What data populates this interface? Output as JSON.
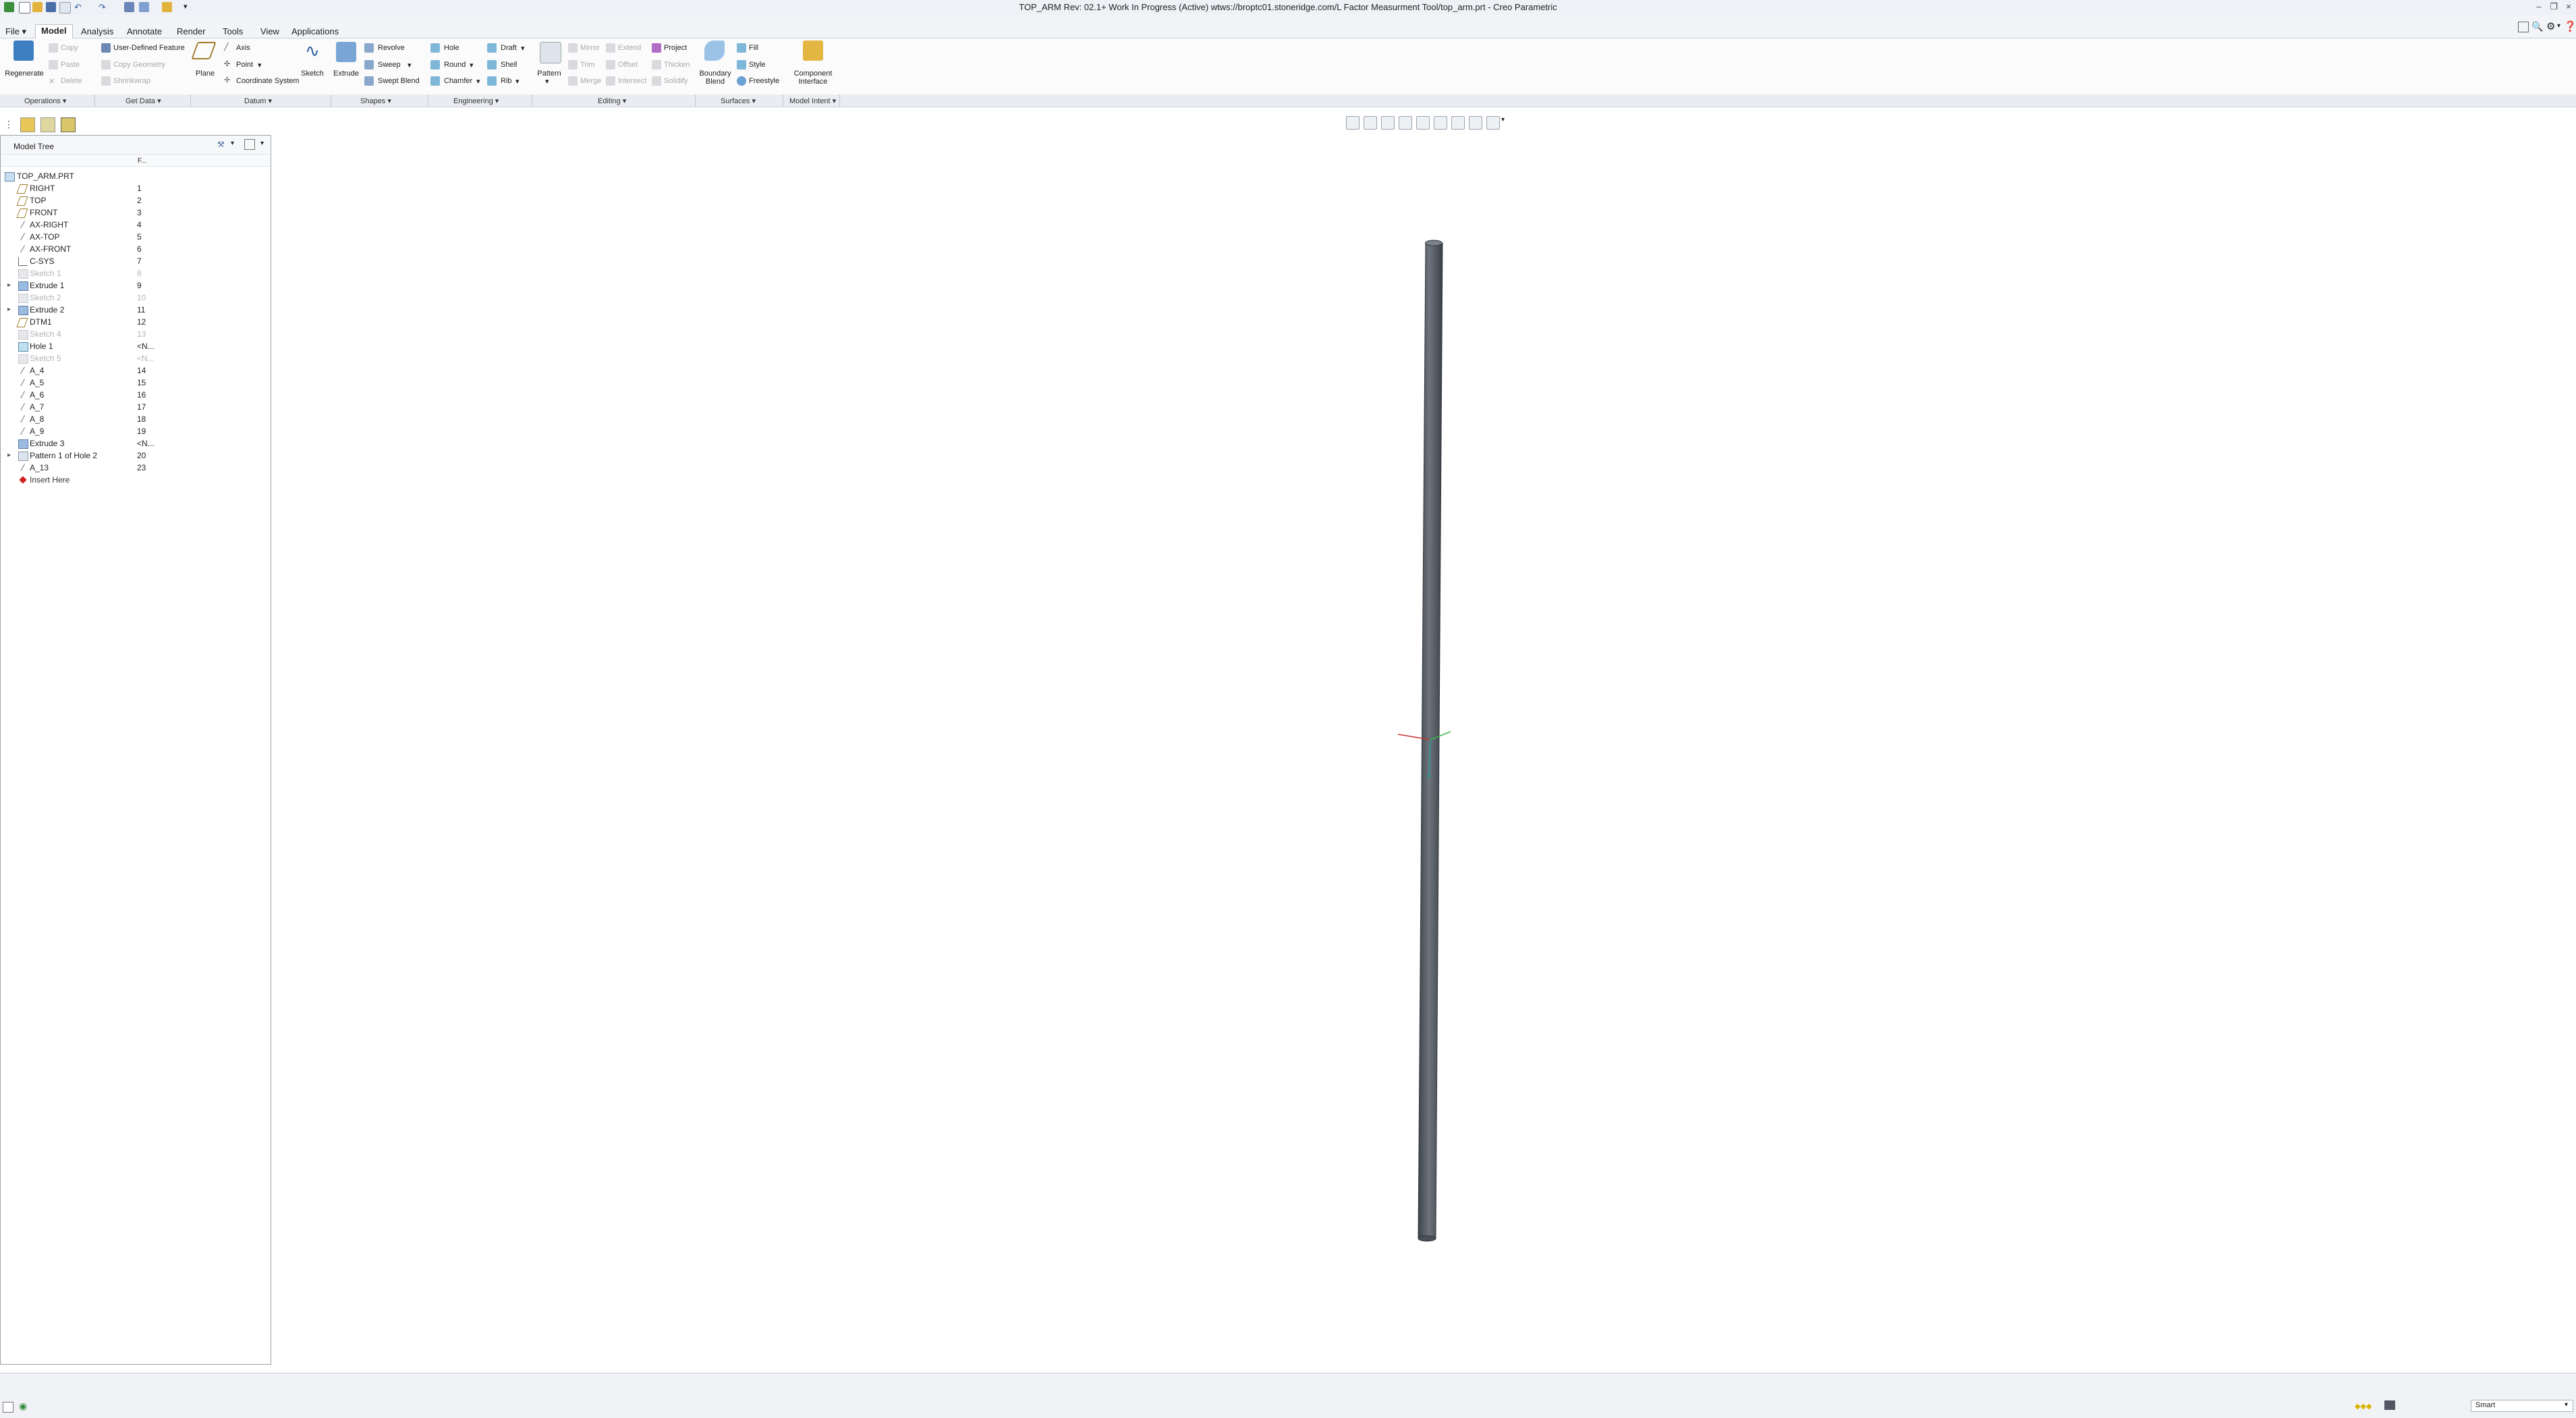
{
  "window": {
    "title": "TOP_ARM Rev: 02.1+ Work In Progress  (Active) wtws://broptc01.stoneridge.com/L Factor Measurment Tool/top_arm.prt - Creo Parametric"
  },
  "menu": {
    "tabs": [
      "File ▾",
      "Model",
      "Analysis",
      "Annotate",
      "Render",
      "Tools",
      "View",
      "Applications"
    ]
  },
  "ribbon": {
    "operations": {
      "regenerate": "Regenerate",
      "copy": "Copy",
      "paste": "Paste",
      "delete": "Delete",
      "user_defined_feature": "User-Defined Feature",
      "copy_geometry": "Copy Geometry",
      "shrinkwrap": "Shrinkwrap"
    },
    "datum": {
      "plane": "Plane",
      "axis": "Axis",
      "point": "Point",
      "coordinate_system": "Coordinate System",
      "sketch": "Sketch"
    },
    "shapes": {
      "extrude": "Extrude",
      "revolve": "Revolve",
      "sweep": "Sweep",
      "swept_blend": "Swept Blend"
    },
    "engineering": {
      "hole": "Hole",
      "round": "Round",
      "chamfer": "Chamfer",
      "draft": "Draft",
      "shell": "Shell",
      "rib": "Rib"
    },
    "editing": {
      "pattern": "Pattern",
      "mirror": "Mirror",
      "trim": "Trim",
      "merge": "Merge",
      "extend": "Extend",
      "offset": "Offset",
      "intersect": "Intersect",
      "project": "Project",
      "thicken": "Thicken",
      "solidify": "Solidify"
    },
    "surfaces": {
      "boundary_blend": "Boundary Blend",
      "fill": "Fill",
      "style": "Style",
      "freestyle": "Freestyle"
    },
    "model_intent": {
      "component_interface": "Component Interface"
    },
    "groups": [
      "Operations ▾",
      "Get Data ▾",
      "Datum ▾",
      "Shapes ▾",
      "Engineering ▾",
      "Editing ▾",
      "Surfaces ▾",
      "Model Intent ▾"
    ]
  },
  "model_tree": {
    "title": "Model Tree",
    "column_header": "F...",
    "root": "TOP_ARM.PRT",
    "items": [
      {
        "label": "RIGHT",
        "num": "1",
        "icon": "datum-plane-icon",
        "dim": false,
        "expand": false
      },
      {
        "label": "TOP",
        "num": "2",
        "icon": "datum-plane-icon",
        "dim": false,
        "expand": false
      },
      {
        "label": "FRONT",
        "num": "3",
        "icon": "datum-plane-icon",
        "dim": false,
        "expand": false
      },
      {
        "label": "AX-RIGHT",
        "num": "4",
        "icon": "datum-axis-icon",
        "dim": false,
        "expand": false
      },
      {
        "label": "AX-TOP",
        "num": "5",
        "icon": "datum-axis-icon",
        "dim": false,
        "expand": false
      },
      {
        "label": "AX-FRONT",
        "num": "6",
        "icon": "datum-axis-icon",
        "dim": false,
        "expand": false
      },
      {
        "label": "C-SYS",
        "num": "7",
        "icon": "csys-icon",
        "dim": false,
        "expand": false
      },
      {
        "label": "Sketch 1",
        "num": "8",
        "icon": "sketch-icon",
        "dim": true,
        "expand": false
      },
      {
        "label": "Extrude 1",
        "num": "9",
        "icon": "extrude-icon",
        "dim": false,
        "expand": true
      },
      {
        "label": "Sketch 2",
        "num": "10",
        "icon": "sketch-icon",
        "dim": true,
        "expand": false
      },
      {
        "label": "Extrude 2",
        "num": "11",
        "icon": "extrude-icon",
        "dim": false,
        "expand": true
      },
      {
        "label": "DTM1",
        "num": "12",
        "icon": "datum-plane-icon",
        "dim": false,
        "expand": false
      },
      {
        "label": "Sketch 4",
        "num": "13",
        "icon": "sketch-icon",
        "dim": true,
        "expand": false
      },
      {
        "label": "Hole 1",
        "num": "<N...",
        "icon": "hole-icon",
        "dim": false,
        "expand": false
      },
      {
        "label": "Sketch 5",
        "num": "<N...",
        "icon": "sketch-icon",
        "dim": true,
        "expand": false
      },
      {
        "label": "A_4",
        "num": "14",
        "icon": "datum-axis-icon",
        "dim": false,
        "expand": false
      },
      {
        "label": "A_5",
        "num": "15",
        "icon": "datum-axis-icon",
        "dim": false,
        "expand": false
      },
      {
        "label": "A_6",
        "num": "16",
        "icon": "datum-axis-icon",
        "dim": false,
        "expand": false
      },
      {
        "label": "A_7",
        "num": "17",
        "icon": "datum-axis-icon",
        "dim": false,
        "expand": false
      },
      {
        "label": "A_8",
        "num": "18",
        "icon": "datum-axis-icon",
        "dim": false,
        "expand": false
      },
      {
        "label": "A_9",
        "num": "19",
        "icon": "datum-axis-icon",
        "dim": false,
        "expand": false
      },
      {
        "label": "Extrude 3",
        "num": "<N...",
        "icon": "extrude-icon",
        "dim": false,
        "expand": false
      },
      {
        "label": "Pattern 1 of Hole 2",
        "num": "20",
        "icon": "pattern-icon",
        "dim": false,
        "expand": true
      },
      {
        "label": "A_13",
        "num": "23",
        "icon": "datum-axis-icon",
        "dim": false,
        "expand": false
      },
      {
        "label": "Insert Here",
        "num": "",
        "icon": "insert-here-icon",
        "dim": false,
        "expand": false
      }
    ]
  },
  "status": {
    "selection_filter": "Smart"
  },
  "colors": {
    "accent": "#2f6fb3",
    "model_body": "#5a6068",
    "insert_here": "#cc2222"
  }
}
